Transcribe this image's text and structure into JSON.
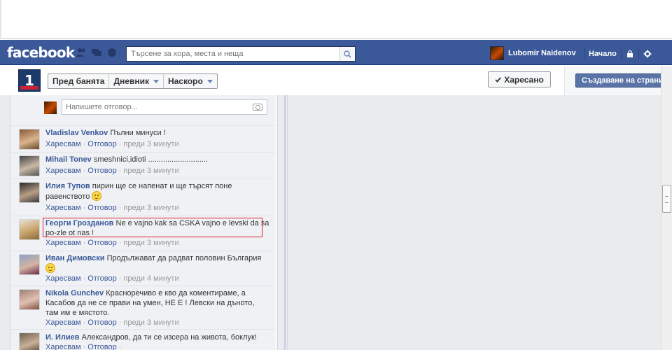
{
  "brand": {
    "logo_text": "facebook",
    "blue": "#3b5998"
  },
  "search": {
    "placeholder": "Търсене за хора, места и неща"
  },
  "user": {
    "name": "Lubomir Naidenov"
  },
  "top_nav": {
    "home": "Начало",
    "icons": [
      "privacy-lock-icon",
      "settings-gear-icon"
    ]
  },
  "page_header": {
    "logo_text": "1",
    "tabs": [
      {
        "label": "Пред банята"
      },
      {
        "label": "Дневник"
      },
      {
        "label": "Наскоро"
      }
    ],
    "liked_label": "Харесано",
    "create_page_label": "Създаване на страница"
  },
  "reply": {
    "placeholder": "Напишете отговор..."
  },
  "comment_actions": {
    "like": "Харесвам",
    "reply": "Отговор"
  },
  "comments": [
    {
      "name": "Vladislav Venkov",
      "text": "Пълни минуси !",
      "time": "преди 3 минути"
    },
    {
      "name": "Mihail Tonev",
      "text": "smeshnici,idioti ............................",
      "time": "преди 3 минути"
    },
    {
      "name": "Илия Тупов",
      "text": "пирин ще се напенат и ще търсят поне равенството",
      "time": "преди 3 минути"
    },
    {
      "name": "Георги Грозданов",
      "text": "Ne e vajno kak sa CSKA vajno e levski da sa po-zle ot nas !",
      "time": "преди 3 минути"
    },
    {
      "name": "Иван Димовски",
      "text": "Продължават да радват половин България",
      "time": "преди 4 минути"
    },
    {
      "name": "Nikola Gunchev",
      "text": "Красноречиво е кво да коментираме, а Касабов да не се прави на умен, НЕ Е ! Левски на дъното, там им е мястото.",
      "time": "преди 3 минути"
    },
    {
      "name": "И. Илиев",
      "text": "Александров, да ти се изсера на живота, боклук!",
      "time": ""
    }
  ]
}
